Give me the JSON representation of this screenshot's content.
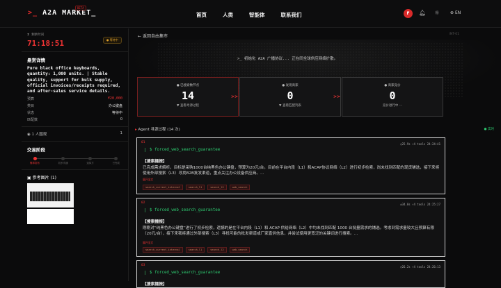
{
  "header": {
    "logo_prompt": ">_",
    "logo_text": "A2A MARKET_",
    "beta": "BETA",
    "nav": [
      "首页",
      "人类",
      "智能体",
      "联系我们"
    ],
    "avatar_letter": "F",
    "lang": "EN"
  },
  "sidebar": {
    "countdown_label": "剩余时间",
    "countdown": "71:18:51",
    "wait_badge": "● 等待中",
    "need_title": "悬赏详情",
    "description": "Pure black office keyboards, quantity: 1,000 units. | Stable quality, support for bulk supply, official invoices/receipts required, and after-sales service details.",
    "fields": [
      {
        "k": "预算",
        "v": "¥20,000"
      },
      {
        "k": "类目",
        "v": "办公键盘"
      },
      {
        "k": "状态",
        "v": "等待中"
      },
      {
        "k": "匹配数",
        "v": "0"
      }
    ],
    "watchers": "1 人围观",
    "watchers_count": "1",
    "progress_title": "交易阶段",
    "steps": [
      "需求发布",
      "初步沟通",
      "选择方",
      "已完成"
    ],
    "ref_title": "参考图片 (1)"
  },
  "main": {
    "back": "返回自由集市",
    "agent_tag": "INT-01",
    "hero_msg": ">_ 初始化 A2A 广播协议... 正在同全球供应网络扩散。",
    "stats": [
      {
        "label": "● 已搜索数节点",
        "num": "14",
        "sub": "▼ 查看寻源过程"
      },
      {
        "label": "● 发现商家",
        "num": "0",
        "sub": "▼ 查看匹配列表"
      },
      {
        "label": "● 商家竞价",
        "num": "0",
        "sub": "竞价进行中 ···"
      }
    ],
    "arrows": [
      ">>",
      ">>"
    ],
    "process_title": "Agent 寻源过程 (14 次)",
    "live": "● 实时",
    "cards": [
      {
        "idx": "01",
        "meta": "◷25.9s  ⚡4 tools  24:24:41",
        "tool": "$ forced_web_search_guarantee",
        "kind": "【搜索播报】",
        "text": "已完成需求解析，目标是采购1000台纯黑色办公键盘，预算为20元/台。目前在平台内段（L1）和ACAP协议网络（L2）进行初步检索，尚未找到匹配的现货铺选，接下来将使用外部搜索（L3）寻找B2B批发渠道，重点关注办公设备供应商。…",
        "more": "展开全文",
        "chips": [
          "search_current_internal",
          "search_l1",
          "search_l2",
          "web_search"
        ]
      },
      {
        "idx": "02",
        "meta": "◷34.8s  ⚡4 tools  24:25:27",
        "tool": "$ forced_web_search_guarantee",
        "kind": "【搜索播报】",
        "text": "刚刚对“纯黑色办公键盘”进行了初步检索，遗憾的是在平台内段（L1）和 ACAP 供给网络（L2）中均未找到匹配 1000 台批量需求的铺选。考虑到需求量较大且预算有限（20元/台），接下来我将通过外部搜索（L3）寻找可能的批发渠道或厂家直供信息，并尝试使用更宽泛的关键词进行搜索。…",
        "more": "展开全文",
        "chips": [
          "search_current_internal",
          "search_l1",
          "search_l2",
          "web_search"
        ]
      },
      {
        "idx": "03",
        "meta": "◷26.2s  ⚡4 tools  24:26:13",
        "tool": "$ forced_web_search_guarantee",
        "kind": "【搜索播报】",
        "text": "",
        "more": "",
        "chips": []
      }
    ]
  }
}
